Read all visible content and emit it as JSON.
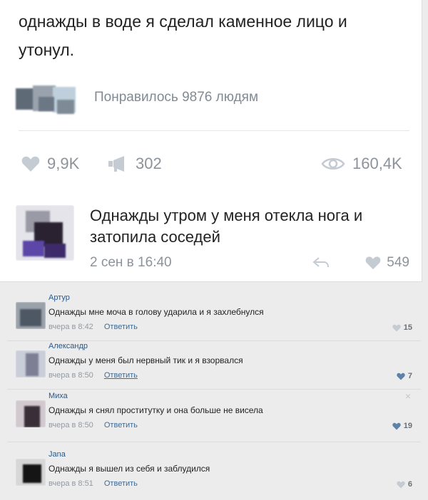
{
  "post": {
    "text": "однажды в воде я сделал каменное лицо и утонул.",
    "likes_summary": "Понравилось 9876 людям",
    "stats": {
      "likes": "9,9K",
      "reposts": "302",
      "views": "160,4K"
    },
    "reply": {
      "text": "Однажды утром у меня отекла нога и затопила соседей",
      "date": "2 сен в 16:40",
      "likes": "549"
    }
  },
  "comments": [
    {
      "author": "Артур",
      "text": "Однажды мне моча в голову ударила и я захлебнулся",
      "time": "вчера в 8:42",
      "reply_label": "Ответить",
      "likes": "15"
    },
    {
      "author": "Александр",
      "text": "Однажды у меня был нервный тик и я взорвался",
      "time": "вчера в 8:50",
      "reply_label": "Ответить",
      "likes": "7"
    },
    {
      "author": "Миха",
      "text": "Однажды я снял проститутку и она больше не висела",
      "time": "вчера в 8:50",
      "reply_label": "Ответить",
      "likes": "19",
      "close": "×"
    },
    {
      "author": "Jana",
      "text": "Однажды я вышел из себя и заблудился",
      "time": "вчера в 8:51",
      "reply_label": "Ответить",
      "likes": "6"
    }
  ],
  "colors": {
    "link": "#2a5885",
    "muted": "#8c939b",
    "card": "#ffffff",
    "page": "#ececec"
  },
  "icons": {
    "like": "heart-icon",
    "repost": "megaphone-icon",
    "views": "eye-icon",
    "share": "share-arrow-icon",
    "close": "close-icon"
  }
}
